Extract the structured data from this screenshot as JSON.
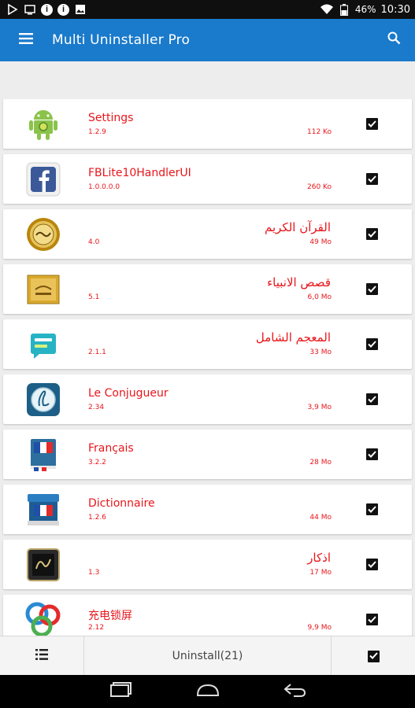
{
  "status_bar": {
    "battery": "46%",
    "time": "10:30",
    "icons": [
      "play-store-icon",
      "screenshot-icon",
      "info-icon",
      "info-icon",
      "image-icon",
      "wifi-icon",
      "battery-icon"
    ]
  },
  "app_bar": {
    "title": "Multi Uninstaller Pro",
    "color": "#1a7acb"
  },
  "apps": [
    {
      "name": "Settings",
      "version": "1.2.9",
      "size": "112 Ko",
      "icon": "android-settings-icon",
      "rtl": false,
      "checked": true
    },
    {
      "name": "FBLite10HandlerUI",
      "version": "1.0.0.0.0",
      "size": "260 Ko",
      "icon": "facebook-icon",
      "rtl": false,
      "checked": true
    },
    {
      "name": "القرآن الكريم",
      "version": "4.0",
      "size": "49 Mo",
      "icon": "quran-icon",
      "rtl": true,
      "checked": true
    },
    {
      "name": "قصص الانبياء",
      "version": "5.1",
      "size": "6,0 Mo",
      "icon": "book-icon",
      "rtl": true,
      "checked": true
    },
    {
      "name": "المعجم الشامل",
      "version": "2.1.1",
      "size": "33 Mo",
      "icon": "dictionary-ar-icon",
      "rtl": true,
      "checked": true
    },
    {
      "name": "Le Conjugueur",
      "version": "2.34",
      "size": "3,9 Mo",
      "icon": "conjugueur-icon",
      "rtl": false,
      "checked": true
    },
    {
      "name": "Français",
      "version": "3.2.2",
      "size": "28 Mo",
      "icon": "french-book-icon",
      "rtl": false,
      "checked": true
    },
    {
      "name": "Dictionnaire",
      "version": "1.2.6",
      "size": "44 Mo",
      "icon": "dictionnaire-icon",
      "rtl": false,
      "checked": true
    },
    {
      "name": "اذكار",
      "version": "1.3",
      "size": "17 Mo",
      "icon": "azkar-icon",
      "rtl": true,
      "checked": true
    },
    {
      "name": "充电锁屏",
      "version": "2.12",
      "size": "9,9 Mo",
      "icon": "go-locker-icon",
      "rtl": false,
      "checked": true
    }
  ],
  "bottom_bar": {
    "uninstall_label": "Uninstall(21)"
  },
  "colors": {
    "accent_text": "#e8161b",
    "status_bar": "#0f0f0f",
    "background": "#ededed"
  }
}
